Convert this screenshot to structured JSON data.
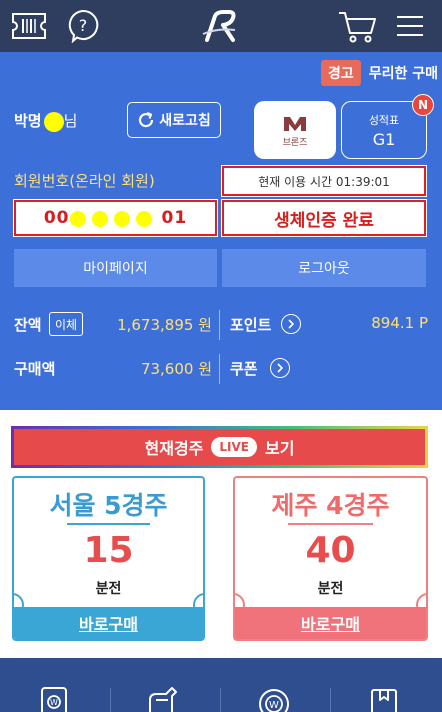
{
  "header": {
    "ticket_icon": "ticket-icon",
    "help_icon": "question-icon",
    "logo_icon": "r-logo-icon",
    "cart_icon": "cart-icon",
    "menu_icon": "hamburger-icon",
    "bg_color": "#2f3e5f"
  },
  "warning": {
    "badge": "경고",
    "text": "무리한 구매"
  },
  "user": {
    "name_visible": "박명",
    "name_suffix": "님",
    "refresh_label": "새로고침",
    "grade_label": "브론즈",
    "score_label": "성적표",
    "score_value": "G1",
    "new_badge": "N"
  },
  "member": {
    "label": "회원번호(온라인 회원)",
    "number_prefix": "00",
    "number_suffix": "01",
    "usage_time": "현재 이용 시간 01:39:01",
    "auth_status": "생체인증 완료"
  },
  "actions": {
    "mypage": "마이페이지",
    "logout": "로그아웃"
  },
  "balance": {
    "label": "잔액",
    "transfer": "이체",
    "value": "1,673,895 원",
    "points_label": "포인트",
    "points_value": "894.1 P",
    "purchase_label": "구매액",
    "purchase_value": "73,600 원",
    "coupon_label": "쿠폰"
  },
  "live": {
    "prefix": "현재경주",
    "pill": "LIVE",
    "suffix": "보기"
  },
  "races": {
    "seoul": {
      "title": "서울 5경주",
      "minutes": "15",
      "unit": "분전",
      "buy": "바로구매"
    },
    "jeju": {
      "title": "제주 4경주",
      "minutes": "40",
      "unit": "분전",
      "buy": "바로구매"
    }
  },
  "colors": {
    "panel": "#3d6fd8",
    "accent_yellow": "#ffe17a",
    "alert_red": "#e01f1f",
    "seoul_blue": "#3aa6d6",
    "jeju_pink": "#f0727a"
  }
}
